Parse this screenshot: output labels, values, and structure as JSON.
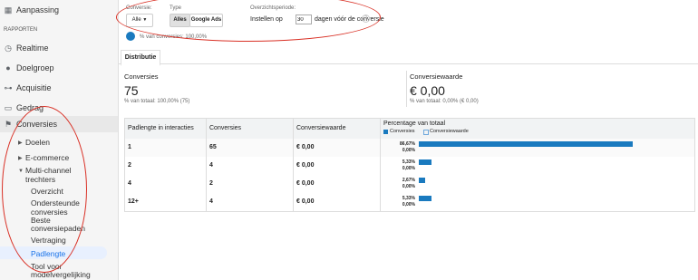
{
  "sidebar": {
    "aanpassing": "Aanpassing",
    "rapporten": "RAPPORTEN",
    "realtime": "Realtime",
    "doelgroep": "Doelgroep",
    "acquisitie": "Acquisitie",
    "gedrag": "Gedrag",
    "conversies": "Conversies",
    "doelen": "Doelen",
    "ecommerce": "E-commerce",
    "multichannel_1": "Multi-channel",
    "multichannel_2": "trechters",
    "overzicht": "Overzicht",
    "ondersteunde_1": "Ondersteunde",
    "ondersteunde_2": "conversies",
    "beste_1": "Beste",
    "beste_2": "conversiepaden",
    "vertraging": "Vertraging",
    "padlengte": "Padlengte",
    "tool_1": "Tool voor",
    "tool_2": "modelvergelijking"
  },
  "filters": {
    "conversie_label": "Conversie:",
    "conversie_value": "Alle",
    "type_label": "Type",
    "type_alles": "Alles",
    "type_google_ads": "Google Ads",
    "periode_label": "Overzichtsperiode:",
    "periode_prefix": "Instellen op",
    "periode_value": "30",
    "periode_suffix": "dagen vóór de conversie",
    "percentage_text": "% van conversies: 100,00%"
  },
  "tab": {
    "label": "Distributie"
  },
  "summary": {
    "conv_label": "Conversies",
    "conv_value": "75",
    "conv_sub": "% van totaal: 100,00% (75)",
    "val_label": "Conversiewaarde",
    "val_value": "€ 0,00",
    "val_sub": "% van totaal: 0,00% (€ 0,00)"
  },
  "table": {
    "headers": [
      "Padlengte in interacties",
      "Conversies",
      "Conversiewaarde",
      "Percentage van totaal"
    ],
    "legend": [
      "Conversies",
      "Conversiewaarde"
    ],
    "rows": [
      {
        "len": "1",
        "conv": "65",
        "val": "€ 0,00",
        "p1": "86,67%",
        "p2": "0,00%",
        "frac": 0.8667
      },
      {
        "len": "2",
        "conv": "4",
        "val": "€ 0,00",
        "p1": "5,33%",
        "p2": "0,00%",
        "frac": 0.0533
      },
      {
        "len": "4",
        "conv": "2",
        "val": "€ 0,00",
        "p1": "2,67%",
        "p2": "0,00%",
        "frac": 0.0267
      },
      {
        "len": "12+",
        "conv": "4",
        "val": "€ 0,00",
        "p1": "5,33%",
        "p2": "0,00%",
        "frac": 0.0533
      }
    ]
  },
  "colors": {
    "bar": "#1a7abf",
    "accent": "#1a73e8",
    "annotation": "#d93025"
  },
  "icons": [
    "gear-icon",
    "clock-icon",
    "person-icon",
    "acquisition-icon",
    "screen-icon",
    "flag-icon",
    "help-icon",
    "dropdown-icon"
  ]
}
